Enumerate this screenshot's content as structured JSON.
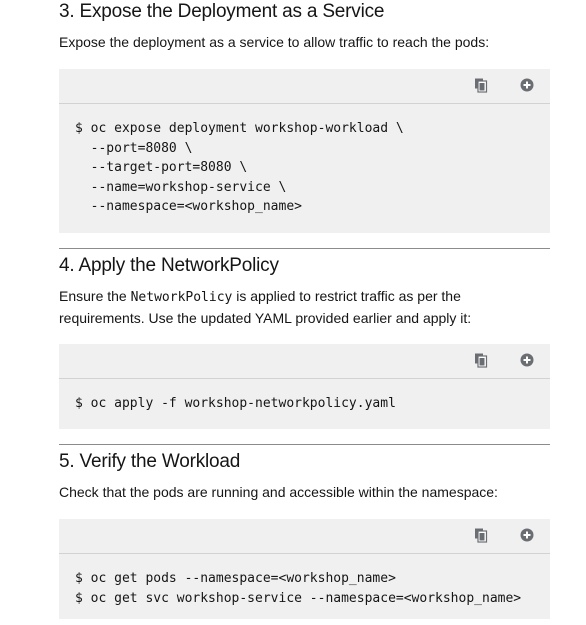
{
  "sections": [
    {
      "title": "3. Expose the Deployment as a Service",
      "description": "Expose the deployment as a service to allow traffic to reach the pods:",
      "code_lines": [
        "$ oc expose deployment workshop-workload \\",
        "  --port=8080 \\",
        "  --target-port=8080 \\",
        "  --name=workshop-service \\",
        "  --namespace=<workshop_name>"
      ]
    },
    {
      "title": "4. Apply the NetworkPolicy",
      "description_before": "Ensure the ",
      "description_code": "NetworkPolicy",
      "description_after": " is applied to restrict traffic as per the",
      "description_line2": "requirements. Use the updated YAML provided earlier and apply it:",
      "code_lines": [
        "$ oc apply -f workshop-networkpolicy.yaml"
      ]
    },
    {
      "title": "5. Verify the Workload",
      "description": "Check that the pods are running and accessible within the namespace:",
      "code_lines": [
        "$ oc get pods --namespace=<workshop_name>",
        "$ oc get svc workshop-service --namespace=<workshop_name>"
      ]
    }
  ],
  "icons": {
    "copy": "copy-icon",
    "expand": "plus-circle-icon"
  },
  "colors": {
    "code_bg": "#f0f0f0",
    "icon": "#6a6e73",
    "divider": "#8a8d90"
  }
}
